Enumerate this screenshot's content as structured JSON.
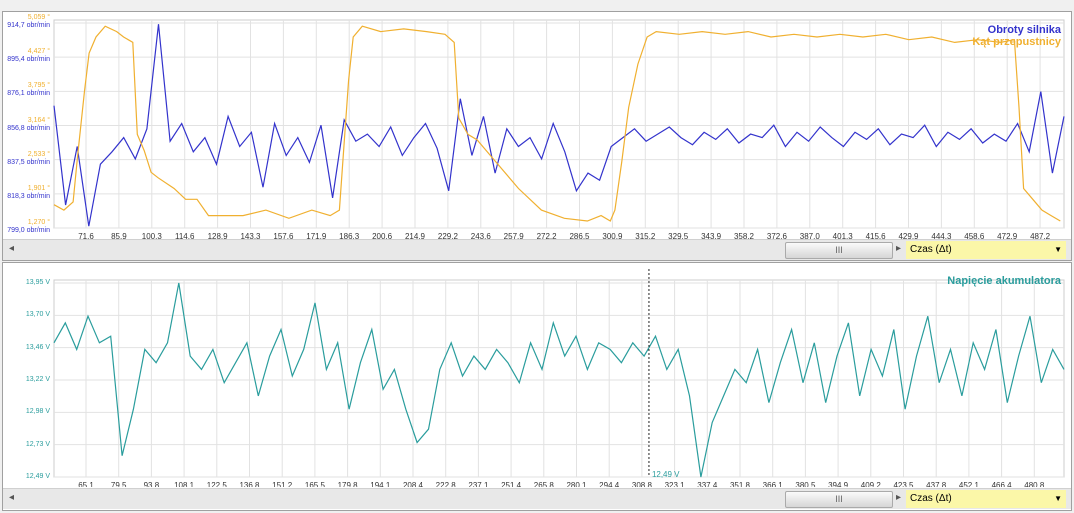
{
  "charts": {
    "top": {
      "legend": [
        "Obroty silnika",
        "Kąt przepustnicy"
      ],
      "scroll_thumb": "III",
      "axis_selector": "Czas (Δt)"
    },
    "bottom": {
      "legend": [
        "Napięcie akumulatora"
      ],
      "scroll_thumb": "III",
      "axis_selector": "Czas (Δt)",
      "cursor_label": "12,49 V"
    }
  },
  "colors": {
    "rpm": "#3333cc",
    "throttle": "#f0b030",
    "voltage": "#2a9d9d"
  },
  "chart_data": [
    {
      "type": "line",
      "title": "",
      "xlabel": "Czas (Δt)",
      "xlim": [
        57.7,
        497.6
      ],
      "x_ticks": [
        "71,6",
        "85,9",
        "100,3",
        "114,6",
        "128,9",
        "143,3",
        "157,6",
        "171,9",
        "186,3",
        "200,6",
        "214,9",
        "229,2",
        "243,6",
        "257,9",
        "272,2",
        "286,5",
        "300,9",
        "315,2",
        "329,5",
        "343,9",
        "358,2",
        "372,6",
        "387,0",
        "401,3",
        "415,6",
        "429,9",
        "444,3",
        "458,6",
        "472,9",
        "487,2"
      ],
      "y_ticks_left": [
        "914,7 obr/min",
        "895,4 obr/min",
        "876,1 obr/min",
        "856,8 obr/min",
        "837,5 obr/min",
        "818,3 obr/min",
        "799,0 obr/min"
      ],
      "y2_ticks": [
        "5,059 °",
        "4,427 °",
        "3,795 °",
        "3,164 °",
        "2,533 °",
        "1,901 °",
        "1,270 °"
      ],
      "legend_position": "top-right",
      "series": [
        {
          "name": "Obroty silnika",
          "ylim": [
            799.0,
            914.7
          ],
          "t_range": [
            57.7,
            497.6
          ],
          "values": [
            868,
            812,
            845,
            800,
            835,
            842,
            850,
            838,
            855,
            914,
            848,
            858,
            842,
            850,
            835,
            862,
            845,
            853,
            822,
            858,
            840,
            850,
            836,
            857,
            816,
            860,
            848,
            852,
            845,
            856,
            840,
            850,
            858,
            844,
            820,
            872,
            840,
            862,
            830,
            855,
            845,
            850,
            838,
            858,
            842,
            820,
            830,
            826,
            845,
            850,
            855,
            848,
            852,
            856,
            850,
            846,
            853,
            849,
            855,
            847,
            852,
            850,
            857,
            845,
            853,
            848,
            856,
            850,
            845,
            853,
            849,
            855,
            846,
            852,
            850,
            857,
            845,
            853,
            849,
            855,
            847,
            852,
            848,
            858,
            842,
            876,
            830,
            862
          ]
        },
        {
          "name": "Kąt przepustnicy",
          "ylim": [
            1.27,
            5.059
          ],
          "points": [
            [
              57.7,
              1.7
            ],
            [
              62,
              1.6
            ],
            [
              66,
              1.75
            ],
            [
              68,
              2.6
            ],
            [
              71,
              3.8
            ],
            [
              73,
              4.5
            ],
            [
              76,
              4.8
            ],
            [
              80,
              5.0
            ],
            [
              85,
              4.9
            ],
            [
              88,
              4.8
            ],
            [
              92,
              4.7
            ],
            [
              94,
              3.0
            ],
            [
              97,
              2.7
            ],
            [
              100,
              2.3
            ],
            [
              103,
              2.2
            ],
            [
              110,
              2.0
            ],
            [
              115,
              1.8
            ],
            [
              120,
              1.8
            ],
            [
              125,
              1.5
            ],
            [
              130,
              1.5
            ],
            [
              140,
              1.5
            ],
            [
              150,
              1.6
            ],
            [
              160,
              1.45
            ],
            [
              170,
              1.6
            ],
            [
              178,
              1.5
            ],
            [
              182,
              1.6
            ],
            [
              184,
              2.8
            ],
            [
              186,
              4.0
            ],
            [
              188,
              4.8
            ],
            [
              192,
              5.0
            ],
            [
              200,
              4.9
            ],
            [
              210,
              4.95
            ],
            [
              220,
              4.9
            ],
            [
              228,
              4.85
            ],
            [
              232,
              4.7
            ],
            [
              234,
              3.3
            ],
            [
              238,
              3.0
            ],
            [
              242,
              2.9
            ],
            [
              250,
              2.5
            ],
            [
              260,
              2.0
            ],
            [
              270,
              1.6
            ],
            [
              280,
              1.45
            ],
            [
              290,
              1.4
            ],
            [
              296,
              1.5
            ],
            [
              300,
              1.4
            ],
            [
              302,
              1.6
            ],
            [
              305,
              2.5
            ],
            [
              308,
              3.5
            ],
            [
              312,
              4.3
            ],
            [
              316,
              4.8
            ],
            [
              320,
              4.9
            ],
            [
              330,
              4.85
            ],
            [
              340,
              4.9
            ],
            [
              350,
              4.85
            ],
            [
              360,
              4.9
            ],
            [
              370,
              4.8
            ],
            [
              380,
              4.85
            ],
            [
              390,
              4.8
            ],
            [
              400,
              4.85
            ],
            [
              410,
              4.8
            ],
            [
              420,
              4.85
            ],
            [
              430,
              4.75
            ],
            [
              440,
              4.8
            ],
            [
              450,
              4.7
            ],
            [
              460,
              4.75
            ],
            [
              470,
              4.7
            ],
            [
              476,
              4.75
            ],
            [
              478,
              3.5
            ],
            [
              480,
              2.0
            ],
            [
              484,
              1.8
            ],
            [
              488,
              1.6
            ],
            [
              492,
              1.5
            ],
            [
              496,
              1.4
            ]
          ]
        }
      ]
    },
    {
      "type": "line",
      "title": "",
      "xlabel": "Czas (Δt)",
      "xlim": [
        51.1,
        493.5
      ],
      "x_ticks": [
        "65,1",
        "79,5",
        "93,8",
        "108,1",
        "122,5",
        "136,8",
        "151,2",
        "165,5",
        "179,8",
        "194,1",
        "208,4",
        "222,8",
        "237,1",
        "251,4",
        "265,8",
        "280,1",
        "294,4",
        "308,8",
        "323,1",
        "337,4",
        "351,8",
        "366,1",
        "380,5",
        "394,9",
        "409,2",
        "423,5",
        "437,8",
        "452,1",
        "466,4",
        "480,8"
      ],
      "y_ticks_left": [
        "13,95 V",
        "13,70 V",
        "13,46 V",
        "13,22 V",
        "12,98 V",
        "12,73 V",
        "12,49 V"
      ],
      "legend_position": "top-right",
      "cursor_t": 311.7,
      "series": [
        {
          "name": "Napięcie akumulatora",
          "ylim": [
            12.49,
            13.95
          ],
          "values": [
            13.5,
            13.65,
            13.45,
            13.7,
            13.5,
            13.55,
            12.65,
            13.0,
            13.45,
            13.35,
            13.5,
            13.95,
            13.4,
            13.3,
            13.45,
            13.2,
            13.35,
            13.5,
            13.1,
            13.4,
            13.6,
            13.25,
            13.45,
            13.8,
            13.3,
            13.5,
            13.0,
            13.35,
            13.6,
            13.15,
            13.3,
            13.0,
            12.75,
            12.85,
            13.3,
            13.5,
            13.25,
            13.4,
            13.3,
            13.45,
            13.35,
            13.2,
            13.5,
            13.3,
            13.65,
            13.4,
            13.55,
            13.3,
            13.5,
            13.45,
            13.35,
            13.5,
            13.4,
            13.55,
            13.3,
            13.45,
            13.1,
            12.49,
            12.9,
            13.1,
            13.3,
            13.2,
            13.45,
            13.05,
            13.35,
            13.6,
            13.2,
            13.5,
            13.05,
            13.4,
            13.65,
            13.1,
            13.45,
            13.25,
            13.6,
            13.0,
            13.4,
            13.7,
            13.2,
            13.45,
            13.1,
            13.5,
            13.3,
            13.6,
            13.05,
            13.4,
            13.7,
            13.2,
            13.45,
            13.3
          ]
        }
      ]
    }
  ]
}
